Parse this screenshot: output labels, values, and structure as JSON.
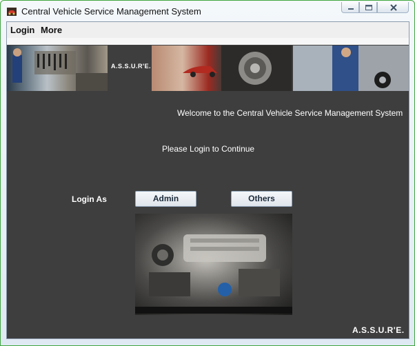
{
  "window": {
    "title": "Central Vehicle Service Management System"
  },
  "menubar": {
    "items": [
      {
        "label": "Login"
      },
      {
        "label": "More"
      }
    ]
  },
  "banner": {
    "logo_text": "A.S.S.U.R'E."
  },
  "main": {
    "welcome_text": "Welcome to the Central Vehicle Service Management System",
    "please_login_text": "Please Login to Continue",
    "login_as_label": "Login As",
    "admin_button_label": "Admin",
    "others_button_label": "Others"
  },
  "footer": {
    "logo_text": "A.S.S.U.R'E."
  }
}
